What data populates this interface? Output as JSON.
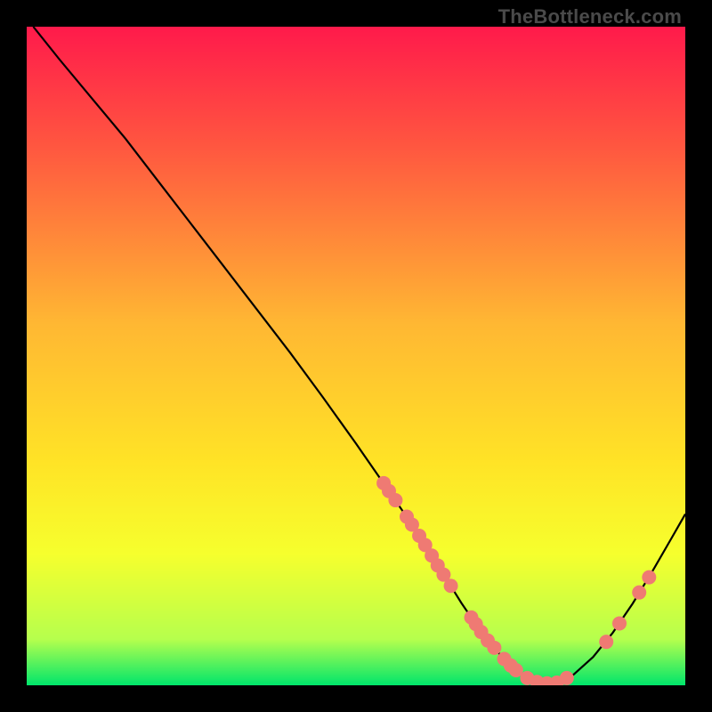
{
  "watermark": "TheBottleneck.com",
  "chart_data": {
    "type": "line",
    "title": "",
    "xlabel": "",
    "ylabel": "",
    "xlim": [
      0,
      100
    ],
    "ylim": [
      0,
      100
    ],
    "grid": false,
    "legend": false,
    "background_gradient_colors": [
      "#ff1a4b",
      "#ff5640",
      "#ffb733",
      "#ffe326",
      "#f6ff2d",
      "#b6ff4d",
      "#00e56b"
    ],
    "series": [
      {
        "name": "curve",
        "type": "line",
        "color": "#000000",
        "x": [
          1,
          5,
          10,
          15,
          20,
          25,
          30,
          35,
          40,
          45,
          50,
          55,
          58.5,
          60,
          63,
          66,
          69,
          72,
          74.5,
          76.5,
          78,
          80,
          83,
          86,
          89,
          92,
          95,
          98,
          100
        ],
        "y": [
          100,
          95,
          89,
          83,
          76.5,
          70,
          63.5,
          57,
          50.5,
          43.7,
          36.7,
          29.5,
          24.4,
          22,
          17.3,
          12.5,
          8.1,
          4.5,
          2.2,
          0.9,
          0.3,
          0.3,
          1.6,
          4.3,
          8.0,
          12.4,
          17.3,
          22.5,
          26.0
        ]
      },
      {
        "name": "points",
        "type": "scatter",
        "color": "#ef7a73",
        "radius_px": 8,
        "x": [
          54.2,
          55.0,
          56.0,
          57.7,
          58.5,
          59.6,
          60.5,
          61.5,
          62.4,
          63.3,
          64.4,
          67.5,
          68.2,
          69.0,
          70.0,
          71.0,
          72.5,
          73.5,
          74.3,
          76.0,
          77.5,
          79.0,
          80.5,
          82.0,
          88.0,
          90.0,
          93.0,
          94.5
        ],
        "y": [
          30.7,
          29.5,
          28.1,
          25.6,
          24.4,
          22.7,
          21.3,
          19.7,
          18.2,
          16.8,
          15.1,
          10.3,
          9.3,
          8.1,
          6.8,
          5.7,
          4.0,
          3.0,
          2.3,
          1.1,
          0.5,
          0.3,
          0.4,
          1.1,
          6.6,
          9.4,
          14.1,
          16.4
        ]
      }
    ]
  }
}
